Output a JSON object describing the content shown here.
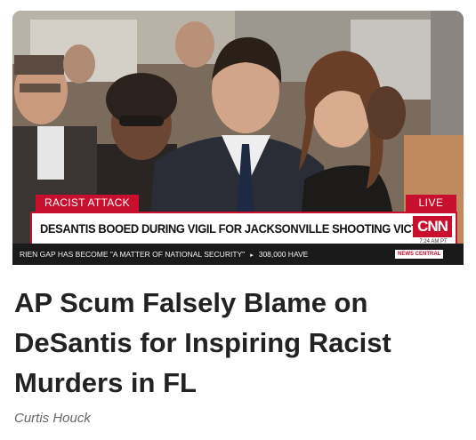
{
  "article": {
    "image": {
      "chyron": {
        "tag": "RACIST ATTACK",
        "live": "LIVE",
        "headline": "DESANTIS BOOED DURING VIGIL FOR JACKSONVILLE SHOOTING VICTIMS",
        "network_logo": "CNN",
        "time": "7:24 AM PT"
      },
      "ticker": {
        "item1": "RIEN GAP HAS BECOME \"A MATTER OF NATIONAL SECURITY\"",
        "separator": "▸",
        "item2": "308,000 HAVE",
        "badge": "NEWS CENTRAL"
      }
    },
    "title_lines": [
      "AP Scum Falsely Blame on",
      "DeSantis for Inspiring Racist",
      "Murders in FL"
    ],
    "author": "Curtis Houck"
  },
  "colors": {
    "cnn_red": "#c8102e",
    "title_text": "#222222",
    "author_text": "#666666"
  }
}
